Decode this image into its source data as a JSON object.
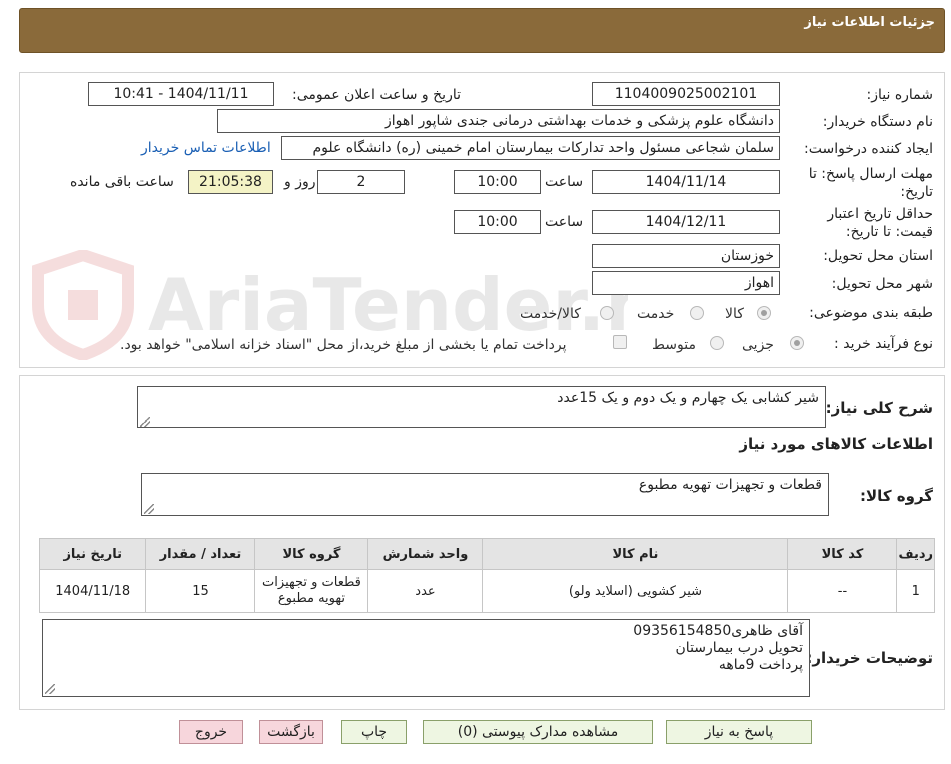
{
  "header": {
    "title": "جزئیات اطلاعات نیاز"
  },
  "form": {
    "need_number": {
      "label": "شماره نیاز:",
      "value": "1104009025002101"
    },
    "announce_datetime": {
      "label": "تاریخ و ساعت اعلان عمومی:",
      "value": "1404/11/11 - 10:41"
    },
    "buyer_org": {
      "label": "نام دستگاه خریدار:",
      "value": "دانشگاه علوم پزشکی و خدمات بهداشتی درمانی جندی شاپور اهواز"
    },
    "requester": {
      "label": "ایجاد کننده درخواست:",
      "value": "سلمان شجاعی مسئول واحد تدارکات بیمارستان امام خمینی (ره) دانشگاه علوم",
      "contact_link": "اطلاعات تماس خریدار"
    },
    "reply_deadline": {
      "label_line1": "مهلت ارسال پاسخ: تا",
      "label_line2": "تاریخ:",
      "date": "1404/11/14",
      "time_label": "ساعت",
      "time": "10:00",
      "days": "2",
      "days_label": "روز و",
      "remaining": "21:05:38",
      "remaining_label": "ساعت باقی مانده"
    },
    "price_validity": {
      "label_line1": "حداقل تاریخ اعتبار",
      "label_line2": "قیمت: تا تاریخ:",
      "date": "1404/12/11",
      "time_label": "ساعت",
      "time": "10:00"
    },
    "province": {
      "label": "استان محل تحویل:",
      "value": "خوزستان"
    },
    "city": {
      "label": "شهر محل تحویل:",
      "value": "اهواز"
    },
    "category": {
      "label": "طبقه بندی موضوعی:",
      "options": [
        "کالا",
        "خدمت",
        "کالا/خدمت"
      ],
      "selected": "کالا"
    },
    "process": {
      "label": "نوع فرآیند خرید :",
      "options": [
        "جزیی",
        "متوسط"
      ],
      "selected": "جزیی",
      "payment_note": "پرداخت تمام یا بخشی از مبلغ خرید،از محل \"اسناد خزانه اسلامی\" خواهد بود."
    }
  },
  "summary": {
    "label": "شرح کلی نیاز:",
    "value": "شیر کشابی یک چهارم و یک دوم و یک        15عدد"
  },
  "goods_section": {
    "title": "اطلاعات کالاهای مورد نیاز",
    "group_label": "گروه کالا:",
    "group_value": "قطعات و تجهیزات تهویه مطبوع"
  },
  "table": {
    "headers": [
      "ردیف",
      "کد کالا",
      "نام کالا",
      "واحد شمارش",
      "گروه کالا",
      "تعداد / مقدار",
      "تاریخ نیاز"
    ],
    "rows": [
      [
        "1",
        "--",
        "شیر کشویی (اسلاید ولو)",
        "عدد",
        "قطعات و تجهیزات تهویه مطبوع",
        "15",
        "1404/11/18"
      ]
    ]
  },
  "buyer_notes": {
    "label": "توضیحات خریدار:",
    "lines": [
      "آقای ظاهری09356154850",
      "تحویل درب بیمارستان",
      "پرداخت 9ماهه"
    ]
  },
  "buttons": {
    "reply": "پاسخ به نیاز",
    "attachments": "مشاهده مدارک پیوستی (0)",
    "print": "چاپ",
    "back": "بازگشت",
    "exit": "خروج"
  },
  "watermark": {
    "text": "AriaTender.neT"
  },
  "colors": {
    "header_bg": "#8a6a3a",
    "link": "#1a5fb4",
    "button_bg": "#eef6e2",
    "button_red_bg": "#f7d6dc",
    "highlight": "#f4f3c6"
  }
}
